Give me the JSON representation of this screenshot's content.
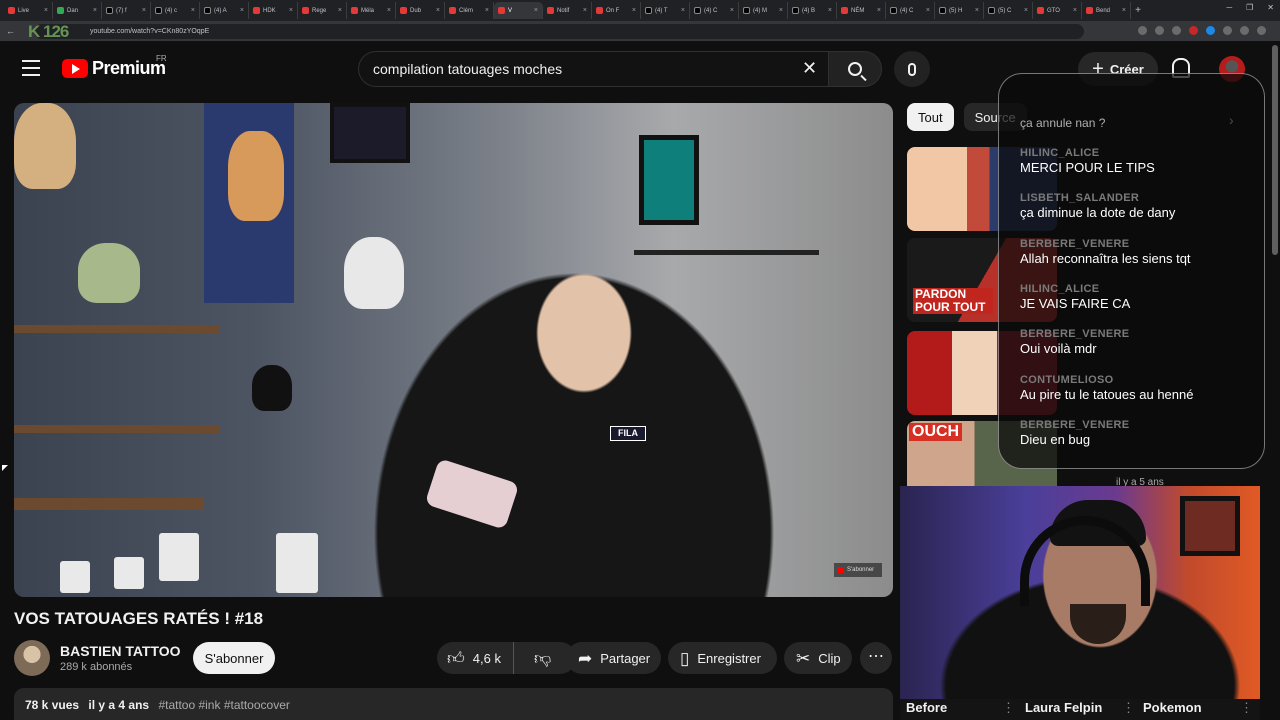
{
  "browser": {
    "tabs": [
      {
        "label": "Live"
      },
      {
        "label": "Dan"
      },
      {
        "label": "(7) f"
      },
      {
        "label": "(4) c"
      },
      {
        "label": "(4) A"
      },
      {
        "label": "HDK"
      },
      {
        "label": "Rege"
      },
      {
        "label": "Méla"
      },
      {
        "label": "Dub"
      },
      {
        "label": "Clém"
      },
      {
        "label": "V"
      },
      {
        "label": "Notif"
      },
      {
        "label": "On F"
      },
      {
        "label": "(4) T"
      },
      {
        "label": "(4) C"
      },
      {
        "label": "(4) M"
      },
      {
        "label": "(4) B"
      },
      {
        "label": "NÉM"
      },
      {
        "label": "(4) C"
      },
      {
        "label": "(5) H"
      },
      {
        "label": "(5) C"
      },
      {
        "label": "GTO"
      },
      {
        "label": "Bend"
      }
    ],
    "url": "youtube.com/watch?v=CKn80zYOqpE",
    "overlay_logo": "K 126"
  },
  "header": {
    "logo_text": "Premium",
    "logo_region": "FR",
    "search_value": "compilation tatouages moches",
    "create_label": "Créer"
  },
  "video": {
    "title": "VOS TATOUAGES RATÉS ! #18",
    "channel": "BASTIEN TATTOO",
    "subscribers": "289 k abonnés",
    "subscribe_label": "S'abonner",
    "likes": "4,6 k",
    "share_label": "Partager",
    "save_label": "Enregistrer",
    "clip_label": "Clip",
    "views": "78 k vues",
    "age": "il y a 4 ans",
    "tags": "#tattoo #ink #tattoocover",
    "shirt_brand": "FILA",
    "watermark": "S'abonner"
  },
  "sidebar": {
    "chips": [
      {
        "label": "Tout"
      },
      {
        "label": "Source"
      }
    ],
    "rec_meta": "il y a 5 ans",
    "thumb_text": [
      "PARDON POUR TOUT",
      "OUCH"
    ]
  },
  "chat": {
    "top_line": "ça annule nan ?",
    "messages": [
      {
        "user": "HILINC_ALICE",
        "text": "MERCI POUR LE TIPS"
      },
      {
        "user": "LISBETH_SALANDER",
        "text": "ça diminue la dote de dany"
      },
      {
        "user": "BERBERE_VENERE",
        "text": "Allah reconnaîtra les siens tqt"
      },
      {
        "user": "HILINC_ALICE",
        "text": "JE VAIS FAIRE CA"
      },
      {
        "user": "BERBERE_VENERE",
        "text": "Oui voilà mdr"
      },
      {
        "user": "CONTUMELIOSO",
        "text": "Au pire tu le tatoues au henné"
      },
      {
        "user": "BERBERE_VENERE",
        "text": "Dieu en bug"
      }
    ]
  },
  "webcam": {
    "labels": [
      "Before",
      "Laura Felpin",
      "Pokemon"
    ]
  },
  "colors": {
    "background": "#0f0f0f",
    "brand_red": "#ff0000",
    "chip_bg": "#272727"
  }
}
